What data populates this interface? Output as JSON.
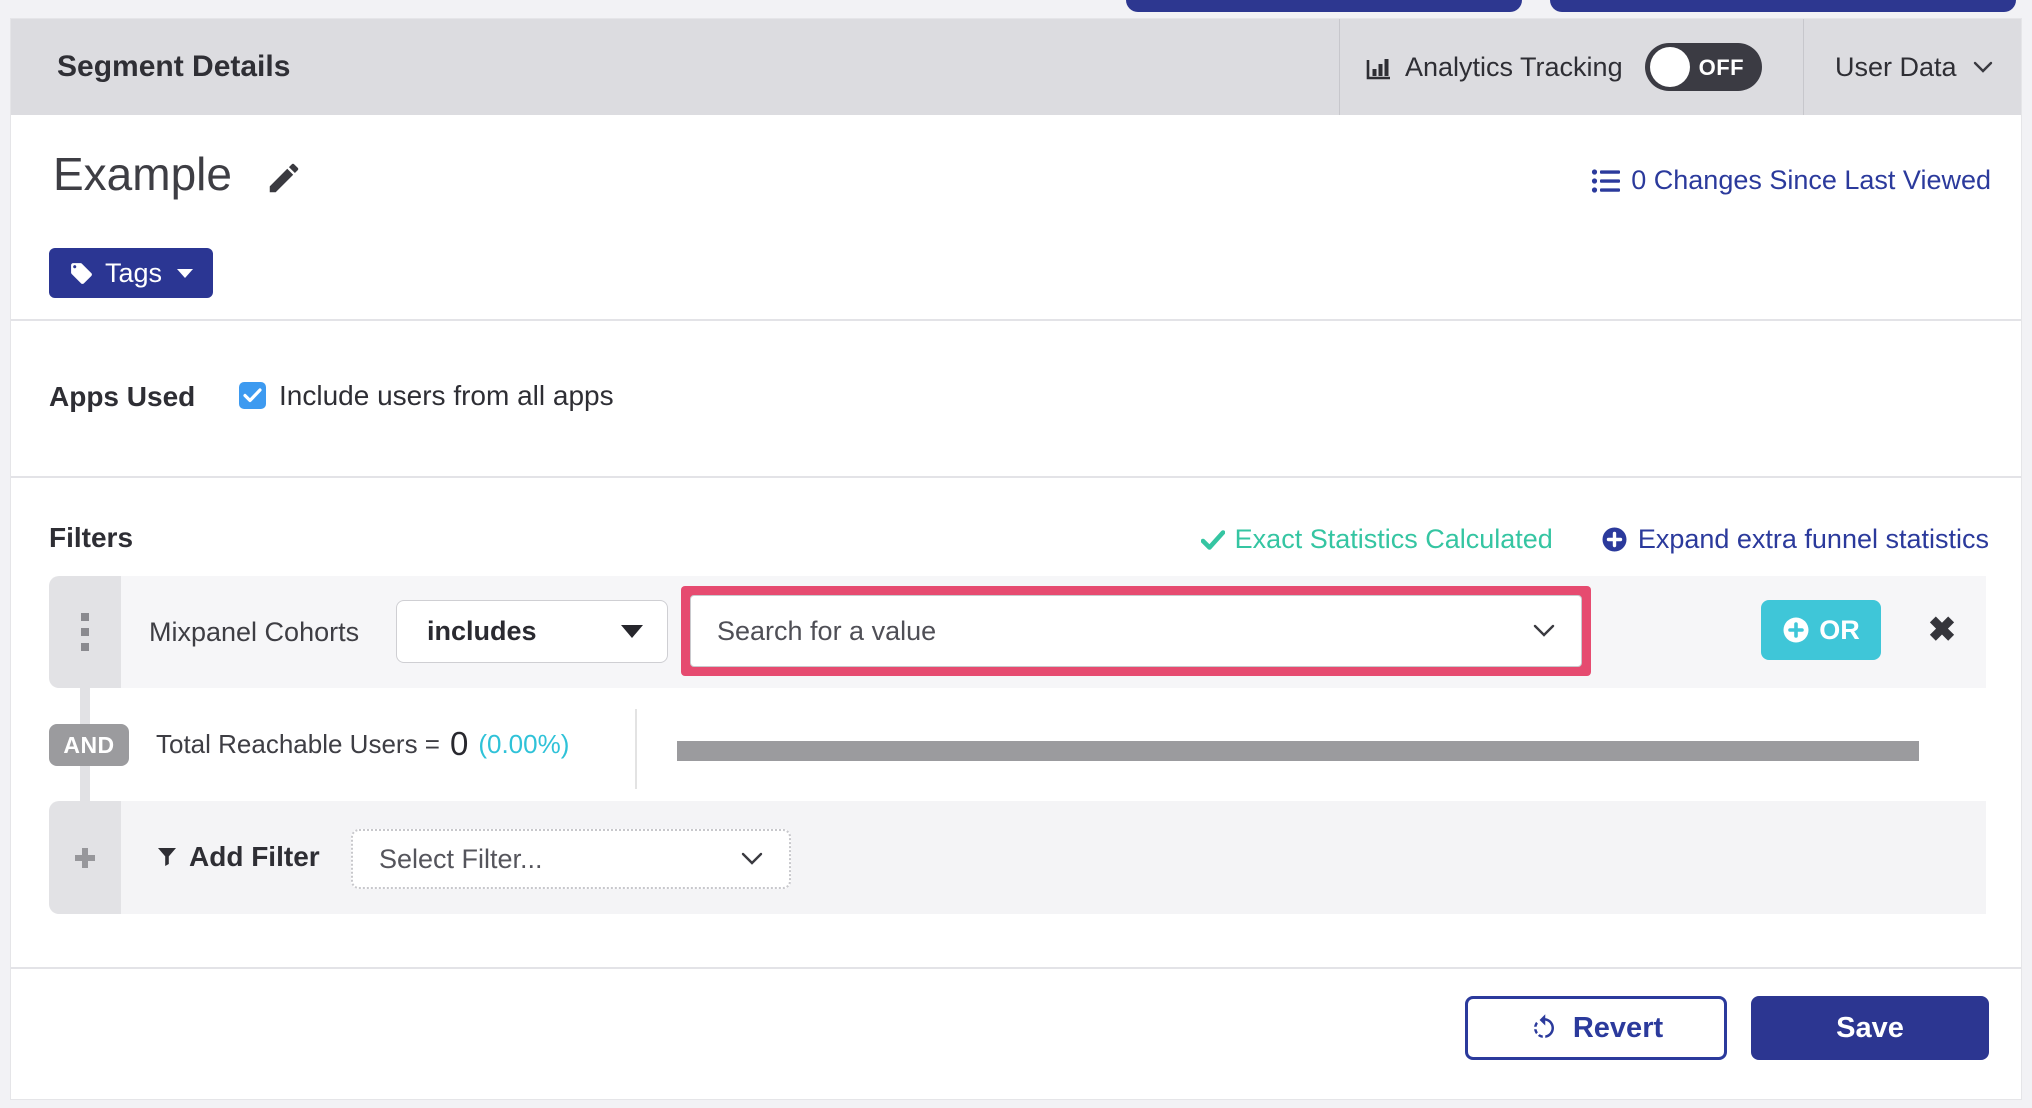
{
  "accents": {
    "brand_blue": "#2b3693",
    "link_blue": "#2b3a9c",
    "teal_success": "#35c5a2",
    "cyan_or": "#3fc6d8",
    "cyan_percent": "#2fc2d8",
    "pink_highlight": "#e64b70",
    "neutral_gray": "#9b9b9e",
    "checkbox_blue": "#3d9af0",
    "toggle_dark": "#3b3b43",
    "header_gray": "#dcdce0"
  },
  "header": {
    "title": "Segment Details",
    "analytics": {
      "label": "Analytics Tracking",
      "state": "OFF"
    },
    "user_data": {
      "label": "User Data"
    }
  },
  "segment": {
    "name": "Example",
    "tags_label": "Tags",
    "changes_link": "0 Changes Since Last Viewed"
  },
  "apps_used": {
    "label": "Apps Used",
    "checkbox_label": "Include users from all apps",
    "checked": true
  },
  "filters": {
    "heading": "Filters",
    "exact_statistics": "Exact Statistics Calculated",
    "expand_link": "Expand extra funnel statistics",
    "row": {
      "attribute": "Mixpanel Cohorts",
      "operator": "includes",
      "value_placeholder": "Search for a value",
      "or_label": "OR"
    },
    "connector_label": "AND",
    "reachable": {
      "prefix": "Total Reachable Users =",
      "count": "0",
      "percent": "(0.00%)"
    },
    "add_filter": {
      "label": "Add Filter",
      "placeholder": "Select Filter..."
    }
  },
  "footer": {
    "revert_label": "Revert",
    "save_label": "Save"
  }
}
